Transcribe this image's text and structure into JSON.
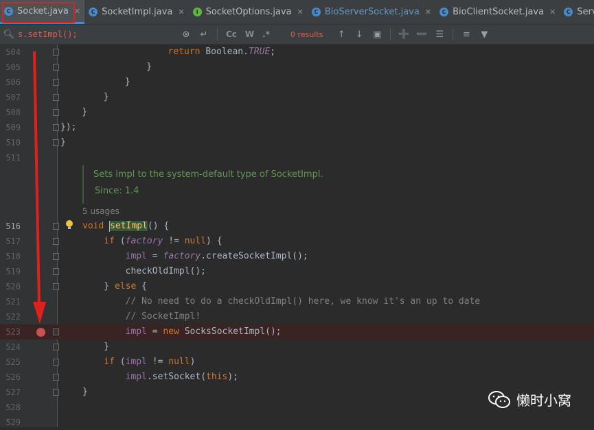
{
  "tabs": [
    {
      "name": "Socket.java",
      "icon": "C",
      "color": "#4a88c7",
      "active": true,
      "name_color": "normal"
    },
    {
      "name": "SocketImpl.java",
      "icon": "C",
      "color": "#4a88c7",
      "active": false,
      "name_color": "normal"
    },
    {
      "name": "SocketOptions.java",
      "icon": "I",
      "color": "#62b543",
      "active": false,
      "name_color": "normal"
    },
    {
      "name": "BioServerSocket.java",
      "icon": "C",
      "color": "#4a88c7",
      "active": false,
      "name_color": "blue"
    },
    {
      "name": "BioClientSocket.java",
      "icon": "C",
      "color": "#4a88c7",
      "active": false,
      "name_color": "normal"
    },
    {
      "name": "ServerSocket.ja",
      "icon": "C",
      "color": "#4a88c7",
      "active": false,
      "name_color": "normal"
    }
  ],
  "search": {
    "query": "s.setImpl();",
    "results": "0 results",
    "match_case": "Cc",
    "words": "W",
    "regex": ".*"
  },
  "editor": {
    "lines": [
      {
        "num": "504",
        "code": "                    return Boolean.TRUE;"
      },
      {
        "num": "505",
        "code": "                }"
      },
      {
        "num": "506",
        "code": "            }"
      },
      {
        "num": "507",
        "code": "        }"
      },
      {
        "num": "508",
        "code": "    }"
      },
      {
        "num": "509",
        "code": "});"
      },
      {
        "num": "510",
        "code": "}"
      },
      {
        "num": "511",
        "code": ""
      },
      {
        "num": "516",
        "code": "void setImpl() {"
      },
      {
        "num": "517",
        "code": "    if (factory != null) {"
      },
      {
        "num": "518",
        "code": "        impl = factory.createSocketImpl();"
      },
      {
        "num": "519",
        "code": "        checkOldImpl();"
      },
      {
        "num": "520",
        "code": "    } else {"
      },
      {
        "num": "521",
        "code": "        // No need to do a checkOldImpl() here, we know it's an up to date"
      },
      {
        "num": "522",
        "code": "        // SocketImpl!"
      },
      {
        "num": "523",
        "code": "        impl = new SocksSocketImpl();"
      },
      {
        "num": "524",
        "code": "    }"
      },
      {
        "num": "525",
        "code": "    if (impl != null)"
      },
      {
        "num": "526",
        "code": "        impl.setSocket(this);"
      },
      {
        "num": "527",
        "code": "}"
      },
      {
        "num": "528",
        "code": ""
      },
      {
        "num": "529",
        "code": ""
      }
    ],
    "doc_text": "Sets impl to the system-default type of SocketImpl.",
    "doc_since": "Since: 1.4",
    "usages": "5 usages",
    "breakpoint_line": "523",
    "current_line": "516"
  },
  "watermark": "懒时小窝",
  "colors": {
    "arrow": "#e0201b",
    "breakpoint": "#c75450",
    "tab_highlight": "#e0201b"
  }
}
